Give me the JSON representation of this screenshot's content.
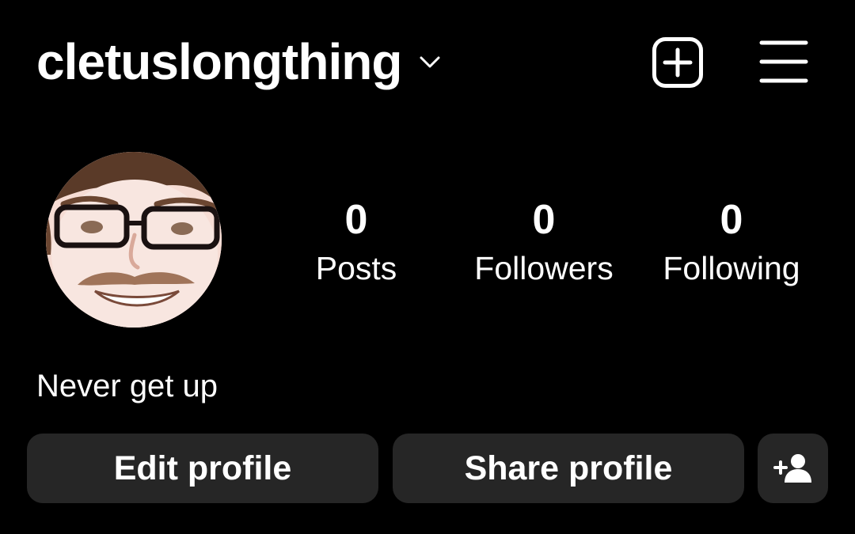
{
  "header": {
    "username": "cletuslongthing",
    "chevron_icon": "chevron-down-icon",
    "create_icon": "plus-square-icon",
    "menu_icon": "hamburger-menu-icon"
  },
  "profile": {
    "avatar": "profile-photo",
    "stats": {
      "posts": {
        "count": "0",
        "label": "Posts"
      },
      "followers": {
        "count": "0",
        "label": "Followers"
      },
      "following": {
        "count": "0",
        "label": "Following"
      }
    },
    "bio": "Never get up"
  },
  "actions": {
    "edit_label": "Edit profile",
    "share_label": "Share profile",
    "discover_icon": "add-person-icon"
  },
  "colors": {
    "background": "#000000",
    "text": "#ffffff",
    "button_bg": "#262626"
  }
}
